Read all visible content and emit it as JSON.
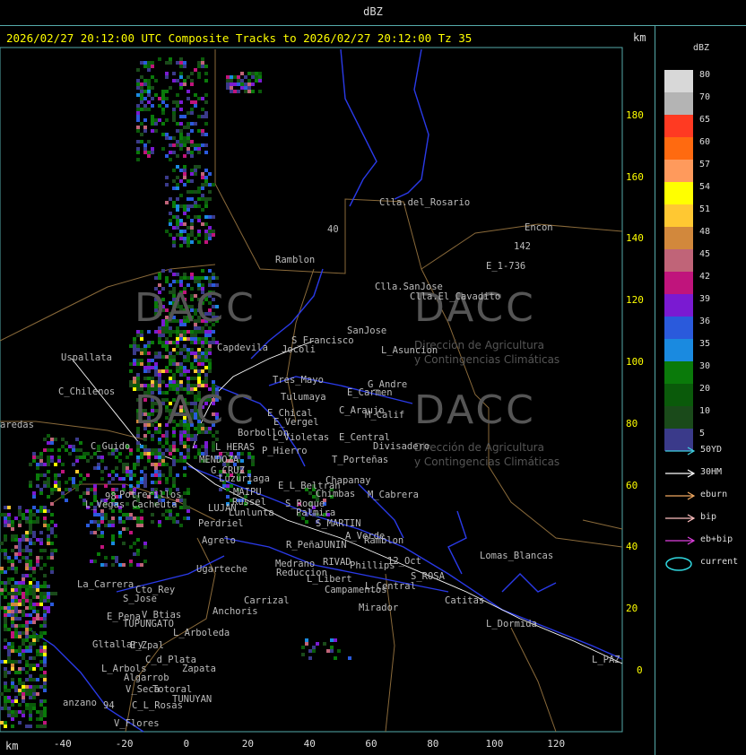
{
  "window": {
    "title": "dBZ"
  },
  "map": {
    "title": "2026/02/27 20:12:00 UTC Composite Tracks to 2026/02/27 20:12:00 Tz 35",
    "units": "km",
    "x_ticks": [
      "-40",
      "-20",
      "0",
      "20",
      "40",
      "60",
      "80",
      "100",
      "120"
    ],
    "y_ticks": [
      "180",
      "160",
      "140",
      "120",
      "100",
      "80",
      "60",
      "40",
      "20",
      "0"
    ],
    "watermark": {
      "brand": "DACC",
      "line1": "Dirección de Agricultura",
      "line2": "y Contingencias Climáticas"
    },
    "places": [
      {
        "name": "Clla.del_Rosario"
      },
      {
        "name": "Encon"
      },
      {
        "name": "Ramblon"
      },
      {
        "name": "E_1-736"
      },
      {
        "name": "142"
      },
      {
        "name": "Clla.SanJose"
      },
      {
        "name": "Clla.El_Cavadito"
      },
      {
        "name": "Uspallata"
      },
      {
        "name": "Capdevila"
      },
      {
        "name": "S_Francisco"
      },
      {
        "name": "SanJose"
      },
      {
        "name": "L_Asuncion"
      },
      {
        "name": "Jocoli"
      },
      {
        "name": "C_Chilenos"
      },
      {
        "name": "Tres_Mayo"
      },
      {
        "name": "Tulumaya"
      },
      {
        "name": "E_Carmen"
      },
      {
        "name": "G_Andre"
      },
      {
        "name": "aredas"
      },
      {
        "name": "E_Chical"
      },
      {
        "name": "E_Vergel"
      },
      {
        "name": "C_Araujo"
      },
      {
        "name": "M_Calif"
      },
      {
        "name": "Borbollon"
      },
      {
        "name": "L_Violetas"
      },
      {
        "name": "E_Central"
      },
      {
        "name": "Divisadero"
      },
      {
        "name": "C_Guido"
      },
      {
        "name": "L_HERAS"
      },
      {
        "name": "P_Hierro"
      },
      {
        "name": "T_Porteñas"
      },
      {
        "name": "MENDOZA"
      },
      {
        "name": "G_CRUZ"
      },
      {
        "name": "Luzuriaga"
      },
      {
        "name": "Chapanay"
      },
      {
        "name": "E_L_Beltran"
      },
      {
        "name": "Potrerillos"
      },
      {
        "name": "Chimbas"
      },
      {
        "name": "M_Cabrera"
      },
      {
        "name": "MAIPU"
      },
      {
        "name": "L_Vegas"
      },
      {
        "name": "Cacheuta"
      },
      {
        "name": "Russel"
      },
      {
        "name": "S_Roque"
      },
      {
        "name": "LUJAN"
      },
      {
        "name": "Lunlunta"
      },
      {
        "name": "Palmira"
      },
      {
        "name": "Perdriel"
      },
      {
        "name": "S_MARTIN"
      },
      {
        "name": "A_Verde"
      },
      {
        "name": "Agrelo"
      },
      {
        "name": "R_Peña"
      },
      {
        "name": "JUNIN"
      },
      {
        "name": "Ramblon"
      },
      {
        "name": "Lomas_Blancas"
      },
      {
        "name": "Ugarteche"
      },
      {
        "name": "Medrano"
      },
      {
        "name": "RIVAD"
      },
      {
        "name": "Phillips"
      },
      {
        "name": "12_Oct"
      },
      {
        "name": "Reduccion"
      },
      {
        "name": "L_Libert"
      },
      {
        "name": "S_ROSA"
      },
      {
        "name": "La_Carrera"
      },
      {
        "name": "Cto_Rey"
      },
      {
        "name": "S_Jose"
      },
      {
        "name": "Campamentos"
      },
      {
        "name": "L_Central"
      },
      {
        "name": "Catitas"
      },
      {
        "name": "Carrizal"
      },
      {
        "name": "E_Pena"
      },
      {
        "name": "V_Btias"
      },
      {
        "name": "Anchoris"
      },
      {
        "name": "Mirador"
      },
      {
        "name": "TUPUNGATO"
      },
      {
        "name": "L_Dormida"
      },
      {
        "name": "L_Arboleda"
      },
      {
        "name": "Gltallary"
      },
      {
        "name": "E_Zpal"
      },
      {
        "name": "C_d_Plata"
      },
      {
        "name": "L_PAZ"
      },
      {
        "name": "L_Arbols"
      },
      {
        "name": "Zapata"
      },
      {
        "name": "Algarrob"
      },
      {
        "name": "V_Seca"
      },
      {
        "name": "Totoral"
      },
      {
        "name": "TUNUYAN"
      },
      {
        "name": "anzano"
      },
      {
        "name": "C_L_Rosas"
      },
      {
        "name": "V_Flores"
      },
      {
        "name": "98"
      },
      {
        "name": "94"
      },
      {
        "name": "40"
      }
    ]
  },
  "legend": {
    "title": "dBZ",
    "scale": [
      {
        "value": "80",
        "color": "#d8d8d8"
      },
      {
        "value": "70",
        "color": "#b4b4b4"
      },
      {
        "value": "65",
        "color": "#ff3a22"
      },
      {
        "value": "60",
        "color": "#ff6a10"
      },
      {
        "value": "57",
        "color": "#ff9a5c"
      },
      {
        "value": "54",
        "color": "#ffff00"
      },
      {
        "value": "51",
        "color": "#ffc832"
      },
      {
        "value": "48",
        "color": "#d2883c"
      },
      {
        "value": "45",
        "color": "#c06478"
      },
      {
        "value": "42",
        "color": "#c0147c"
      },
      {
        "value": "39",
        "color": "#7a1ad2"
      },
      {
        "value": "36",
        "color": "#2a5adc"
      },
      {
        "value": "35",
        "color": "#1a8ae0"
      },
      {
        "value": "30",
        "color": "#0a7a0a"
      },
      {
        "value": "20",
        "color": "#0a5a0a"
      },
      {
        "value": "10",
        "color": "#1a4a1a"
      },
      {
        "value": "5",
        "color": "#3a3a8a"
      }
    ],
    "tracks": [
      {
        "label": "50YD",
        "color": "#40d0e0"
      },
      {
        "label": "30HM",
        "color": "#ffffff"
      },
      {
        "label": "eburn",
        "color": "#f0a860"
      },
      {
        "label": "bip",
        "color": "#ffc0c0"
      },
      {
        "label": "eb+bip",
        "color": "#e040e0"
      }
    ],
    "current": {
      "label": "current",
      "color": "#30d8e0"
    }
  }
}
